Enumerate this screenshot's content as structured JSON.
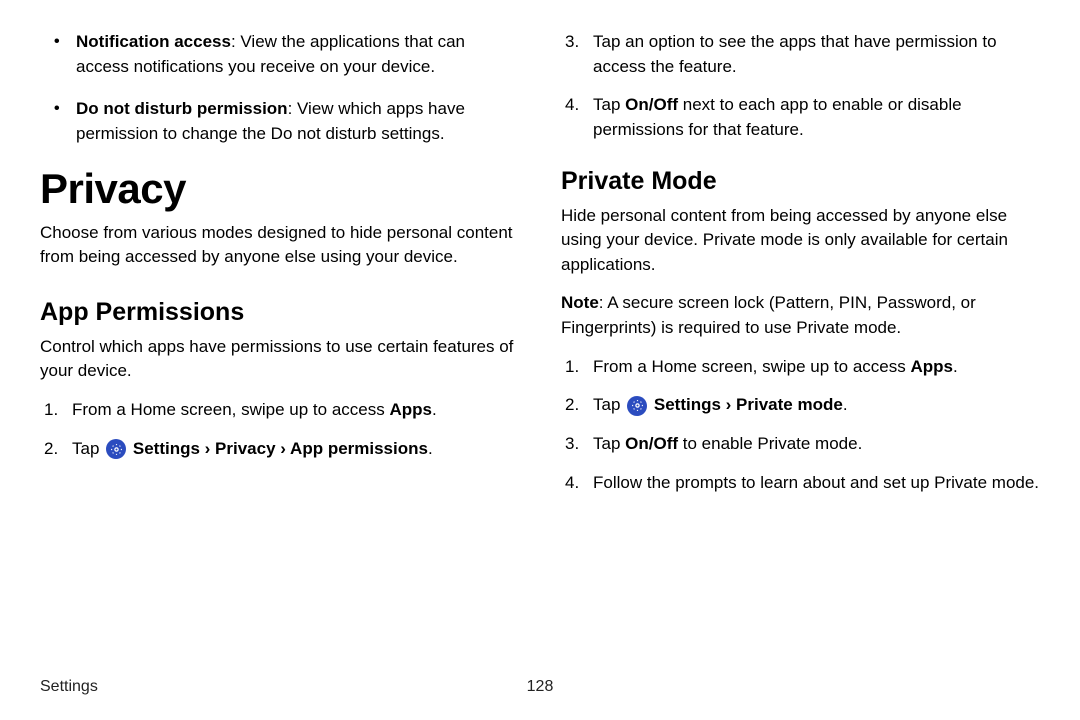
{
  "left": {
    "bullets": [
      {
        "term": "Notification access",
        "desc": ": View the applications that can access notifications you receive on your device."
      },
      {
        "term": "Do not disturb permission",
        "desc": ": View which apps have permission to change the Do not disturb settings."
      }
    ],
    "h1": "Privacy",
    "intro": "Choose from various modes designed to hide personal content from being accessed by anyone else using your device.",
    "h2": "App Permissions",
    "sub_intro": "Control which apps have permissions to use certain features of your device.",
    "step1_pre": "From a Home screen, swipe up to access ",
    "step1_bold": "Apps",
    "step1_post": ".",
    "step2_pre": "Tap ",
    "step2_settings": " Settings ",
    "step2_privacy": " Privacy ",
    "step2_appperm": " App permissions",
    "step2_post": ".",
    "chev": "›"
  },
  "right": {
    "step3": "Tap an option to see the apps that have permission to access the feature.",
    "step4_pre": "Tap ",
    "step4_bold": "On/Off",
    "step4_post": " next to each app to enable or disable permissions for that feature.",
    "h2": "Private Mode",
    "intro": "Hide personal content from being accessed by anyone else using your device. Private mode is only available for certain applications.",
    "note_label": "Note",
    "note_body": ": A secure screen lock (Pattern, PIN, Password, or Fingerprints) is required to use Private mode.",
    "pm_step1_pre": "From a Home screen, swipe up to access ",
    "pm_step1_bold": "Apps",
    "pm_step1_post": ".",
    "pm_step2_pre": "Tap ",
    "pm_step2_settings": " Settings ",
    "pm_step2_pmode": " Private mode",
    "pm_step2_post": ".",
    "pm_step3_pre": "Tap ",
    "pm_step3_bold": "On/Off",
    "pm_step3_post": " to enable Private mode.",
    "pm_step4": "Follow the prompts to learn about and set up Private mode.",
    "chev": "›"
  },
  "footer": {
    "section": "Settings",
    "page": "128"
  }
}
